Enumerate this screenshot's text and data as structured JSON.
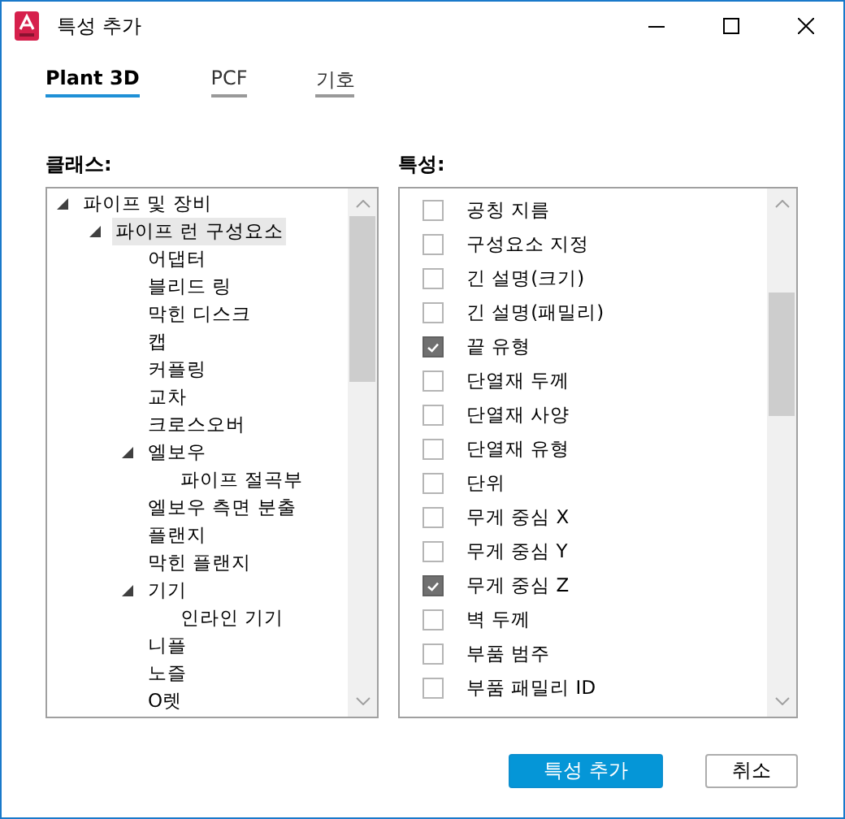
{
  "window": {
    "title": "특성 추가"
  },
  "tabs": [
    {
      "label": "Plant 3D",
      "selected": true
    },
    {
      "label": "PCF",
      "selected": false
    },
    {
      "label": "기호",
      "selected": false
    }
  ],
  "classes": {
    "label": "클래스:",
    "tree": [
      {
        "label": "파이프 및 장비",
        "expanded": true,
        "selected": false,
        "children": [
          {
            "label": "파이프 런 구성요소",
            "expanded": true,
            "selected": true,
            "children": [
              {
                "label": "어댑터",
                "selected": false
              },
              {
                "label": "블리드 링",
                "selected": false
              },
              {
                "label": "막힌 디스크",
                "selected": false
              },
              {
                "label": "캡",
                "selected": false
              },
              {
                "label": "커플링",
                "selected": false
              },
              {
                "label": "교차",
                "selected": false
              },
              {
                "label": "크로스오버",
                "selected": false
              },
              {
                "label": "엘보우",
                "expanded": true,
                "selected": false,
                "children": [
                  {
                    "label": "파이프 절곡부",
                    "selected": false
                  }
                ]
              },
              {
                "label": "엘보우 측면 분출",
                "selected": false
              },
              {
                "label": "플랜지",
                "selected": false
              },
              {
                "label": "막힌 플랜지",
                "selected": false
              },
              {
                "label": "기기",
                "expanded": true,
                "selected": false,
                "children": [
                  {
                    "label": "인라인 기기",
                    "selected": false
                  }
                ]
              },
              {
                "label": "니플",
                "selected": false
              },
              {
                "label": "노즐",
                "selected": false
              },
              {
                "label": "O렛",
                "selected": false
              }
            ]
          }
        ]
      }
    ]
  },
  "properties": {
    "label": "특성:",
    "items": [
      {
        "label": "공칭 지름",
        "checked": false
      },
      {
        "label": "구성요소 지정",
        "checked": false
      },
      {
        "label": "긴 설명(크기)",
        "checked": false
      },
      {
        "label": "긴 설명(패밀리)",
        "checked": false
      },
      {
        "label": "끝 유형",
        "checked": true
      },
      {
        "label": "단열재 두께",
        "checked": false
      },
      {
        "label": "단열재 사양",
        "checked": false
      },
      {
        "label": "단열재 유형",
        "checked": false
      },
      {
        "label": "단위",
        "checked": false
      },
      {
        "label": "무게 중심 X",
        "checked": false
      },
      {
        "label": "무게 중심 Y",
        "checked": false
      },
      {
        "label": "무게 중심 Z",
        "checked": true
      },
      {
        "label": "벽 두께",
        "checked": false
      },
      {
        "label": "부품 범주",
        "checked": false
      },
      {
        "label": "부품 패밀리 ID",
        "checked": false
      }
    ]
  },
  "buttons": [
    {
      "label": "특성 추가",
      "kind": "primary"
    },
    {
      "label": "취소",
      "kind": "secondary"
    }
  ]
}
